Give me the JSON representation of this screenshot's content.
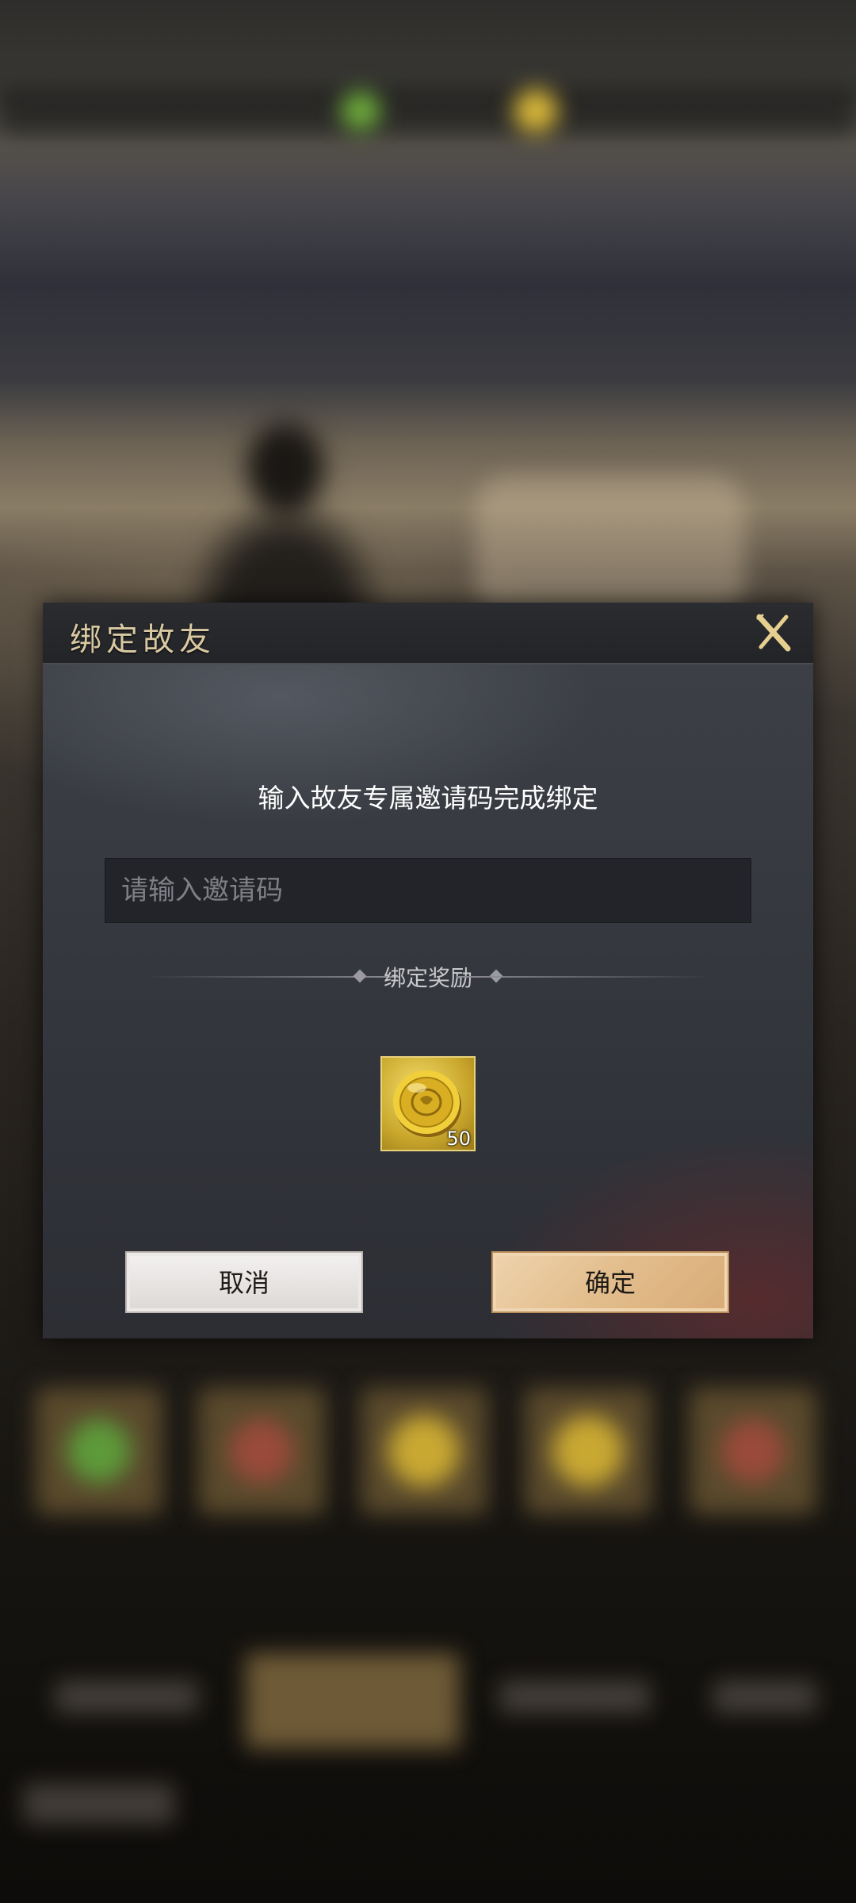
{
  "dialog": {
    "title": "绑定故友",
    "close_icon": "close-icon",
    "instruction": "输入故友专属邀请码完成绑定",
    "input": {
      "value": "",
      "placeholder": "请输入邀请码"
    },
    "reward_section_label": "绑定奖励",
    "rewards": [
      {
        "icon": "gold-coin-icon",
        "quantity": "50"
      }
    ],
    "buttons": {
      "cancel": "取消",
      "confirm": "确定"
    }
  },
  "colors": {
    "title_gold": "#d8c9a2",
    "confirm_button": "#e2bd8c",
    "cancel_button": "#e8e5e3",
    "coin_gold": "#d4b030"
  }
}
